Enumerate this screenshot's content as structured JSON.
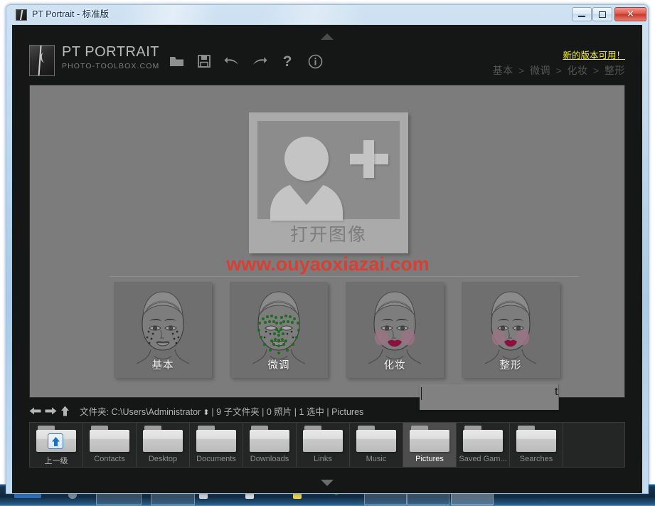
{
  "window": {
    "title": "PT Portrait - 标准版",
    "icon": "app-icon",
    "caption_buttons": [
      {
        "name": "minimize",
        "glyph": "minimize"
      },
      {
        "name": "maximize",
        "glyph": "maximize"
      },
      {
        "name": "close",
        "glyph": "✕"
      }
    ]
  },
  "header": {
    "brand_name": "PT PORTRAIT",
    "brand_sub": "PHOTO-TOOLBOX.COM",
    "update_link": "新的版本可用！",
    "update_link_color": "#f5f522",
    "toolbar": [
      {
        "name": "open-folder-icon",
        "title": "open"
      },
      {
        "name": "save-icon",
        "title": "save"
      },
      {
        "name": "undo-icon",
        "title": "undo"
      },
      {
        "name": "redo-icon",
        "title": "redo"
      },
      {
        "name": "help-icon",
        "title": "help",
        "glyph": "?"
      },
      {
        "name": "info-icon",
        "title": "info",
        "glyph": "i"
      }
    ],
    "breadcrumb": [
      "基本",
      "微调",
      "化妆",
      "整形"
    ],
    "breadcrumb_separator": ">"
  },
  "canvas": {
    "open_image_label": "打开图像",
    "watermark": "www.ouyaoxiazai.com",
    "watermark_color": "#e03a30",
    "background_color": "#7b7c7b",
    "thumbnails": [
      {
        "label": "基本",
        "style": "freckles"
      },
      {
        "label": "微调",
        "style": "green-points"
      },
      {
        "label": "化妆",
        "style": "makeup"
      },
      {
        "label": "整形",
        "style": "reshape"
      }
    ]
  },
  "statusbar": {
    "back_icon": "arrow-left-icon",
    "forward_icon": "arrow-right-icon",
    "up_icon": "arrow-up-icon",
    "folder_label": "文件夹:",
    "folder_path": "C:\\Users\\Administrator",
    "stepper": "⬍",
    "subfolders": "9 子文件夹",
    "photos": "0 照片",
    "selected": "1 选中",
    "current_folder": "Pictures",
    "separator": "|"
  },
  "folderstrip": {
    "items": [
      {
        "label": "上一级",
        "type": "up",
        "selected": false
      },
      {
        "label": "Contacts",
        "type": "folder",
        "selected": false
      },
      {
        "label": "Desktop",
        "type": "folder",
        "selected": false
      },
      {
        "label": "Documents",
        "type": "folder",
        "selected": false
      },
      {
        "label": "Downloads",
        "type": "folder",
        "selected": false
      },
      {
        "label": "Links",
        "type": "folder",
        "selected": false
      },
      {
        "label": "Music",
        "type": "folder",
        "selected": false
      },
      {
        "label": "Pictures",
        "type": "folder",
        "selected": true
      },
      {
        "label": "Saved Gam...",
        "type": "folder",
        "selected": false
      },
      {
        "label": "Searches",
        "type": "folder",
        "selected": false
      }
    ]
  },
  "collapse": {
    "top_arrow": "chevron-up-icon",
    "bottom_arrow": "chevron-down-icon"
  },
  "overlay_fragment": {
    "text": "t"
  }
}
